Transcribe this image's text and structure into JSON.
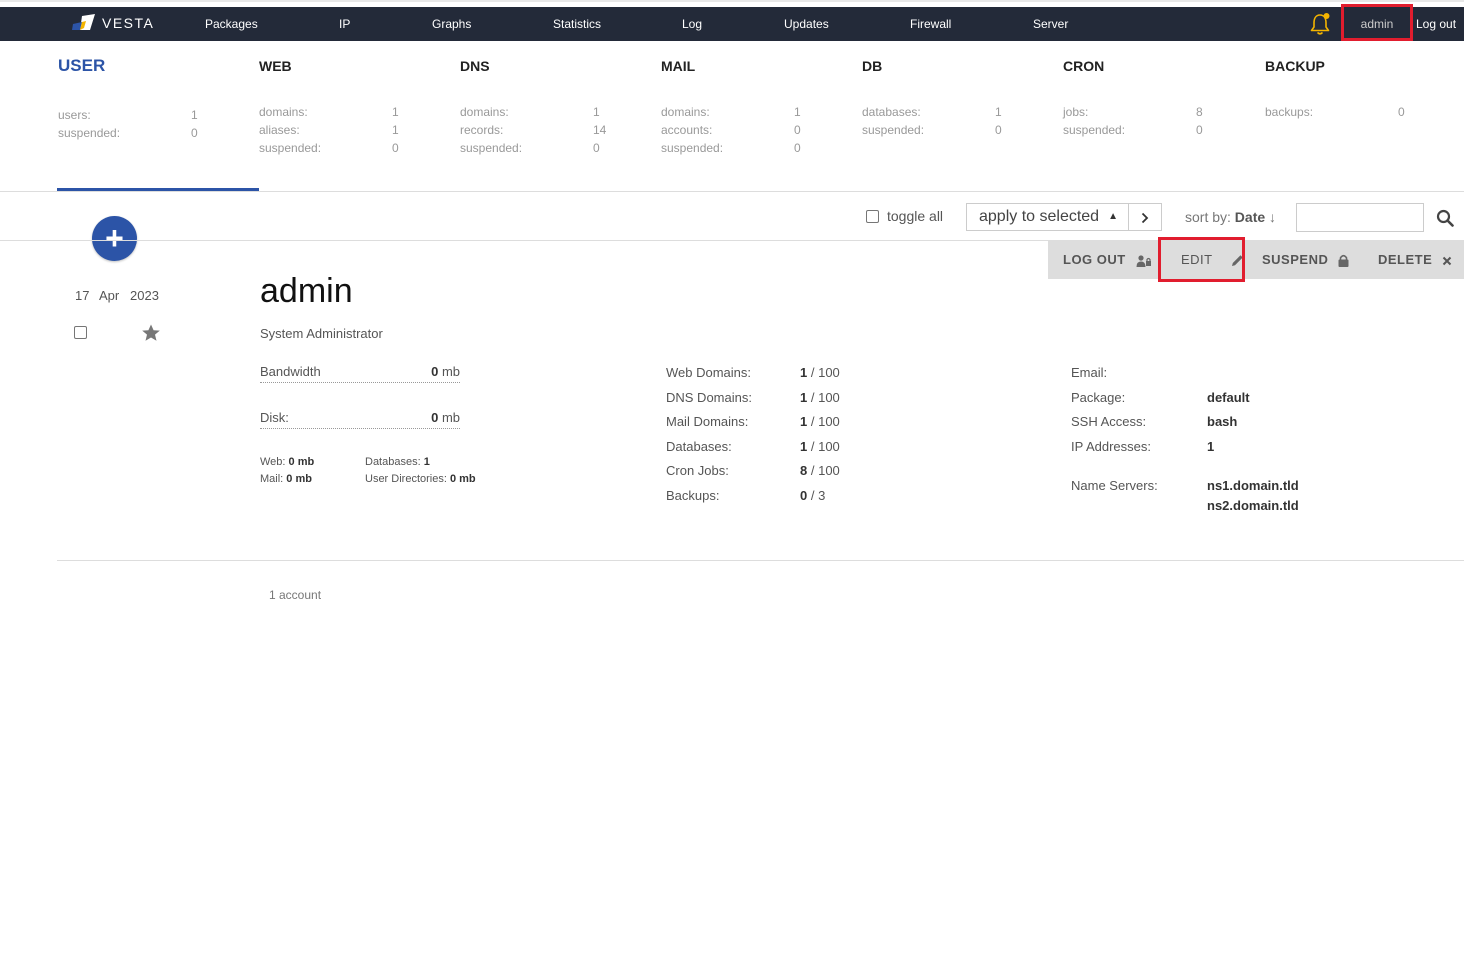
{
  "topbar": {
    "logo_text": "VESTA",
    "nav": [
      "Packages",
      "IP",
      "Graphs",
      "Statistics",
      "Log",
      "Updates",
      "Firewall",
      "Server"
    ],
    "user": "admin",
    "logout": "Log out"
  },
  "stats": [
    {
      "title": "USER",
      "rows": [
        {
          "label": "users:",
          "value": "1"
        },
        {
          "label": "suspended:",
          "value": "0"
        }
      ]
    },
    {
      "title": "WEB",
      "rows": [
        {
          "label": "domains:",
          "value": "1"
        },
        {
          "label": "aliases:",
          "value": "1"
        },
        {
          "label": "suspended:",
          "value": "0"
        }
      ]
    },
    {
      "title": "DNS",
      "rows": [
        {
          "label": "domains:",
          "value": "1"
        },
        {
          "label": "records:",
          "value": "14"
        },
        {
          "label": "suspended:",
          "value": "0"
        }
      ]
    },
    {
      "title": "MAIL",
      "rows": [
        {
          "label": "domains:",
          "value": "1"
        },
        {
          "label": "accounts:",
          "value": "0"
        },
        {
          "label": "suspended:",
          "value": "0"
        }
      ]
    },
    {
      "title": "DB",
      "rows": [
        {
          "label": "databases:",
          "value": "1"
        },
        {
          "label": "suspended:",
          "value": "0"
        }
      ]
    },
    {
      "title": "CRON",
      "rows": [
        {
          "label": "jobs:",
          "value": "8"
        },
        {
          "label": "suspended:",
          "value": "0"
        }
      ]
    },
    {
      "title": "BACKUP",
      "rows": [
        {
          "label": "backups:",
          "value": "0"
        }
      ]
    }
  ],
  "toolbar": {
    "toggle_all": "toggle all",
    "apply": "apply to selected",
    "sort_label": "sort by:",
    "sort_value": "Date",
    "sort_dir": "↓",
    "search_value": ""
  },
  "actions": {
    "logout": "LOG OUT",
    "edit": "EDIT",
    "suspend": "SUSPEND",
    "delete": "DELETE"
  },
  "user": {
    "date_day": "17",
    "date_month": "Apr",
    "date_year": "2023",
    "name": "admin",
    "full_name": "System Administrator",
    "bandwidth_label": "Bandwidth",
    "bandwidth_value": "0",
    "bandwidth_unit": "mb",
    "disk_label": "Disk:",
    "disk_value": "0",
    "disk_unit": "mb",
    "web_label": "Web:",
    "web_value": "0 mb",
    "mail_label": "Mail:",
    "mail_value": "0 mb",
    "databases_label": "Databases:",
    "databases_value": "1",
    "userdirs_label": "User Directories:",
    "userdirs_value": "0 mb",
    "limits": [
      {
        "label": "Web Domains:",
        "used": "1",
        "total": "/ 100"
      },
      {
        "label": "DNS Domains:",
        "used": "1",
        "total": "/ 100"
      },
      {
        "label": "Mail Domains:",
        "used": "1",
        "total": "/ 100"
      },
      {
        "label": "Databases:",
        "used": "1",
        "total": "/ 100"
      },
      {
        "label": "Cron Jobs:",
        "used": "8",
        "total": "/ 100"
      },
      {
        "label": "Backups:",
        "used": "0",
        "total": "/ 3"
      }
    ],
    "info": [
      {
        "label": "Email:",
        "value": ""
      },
      {
        "label": "Package:",
        "value": "default"
      },
      {
        "label": "SSH Access:",
        "value": "bash"
      },
      {
        "label": "IP Addresses:",
        "value": "1"
      }
    ],
    "ns_label": "Name Servers:",
    "ns": [
      "ns1.domain.tld",
      "ns2.domain.tld"
    ]
  },
  "footer": {
    "count": "1 account"
  }
}
